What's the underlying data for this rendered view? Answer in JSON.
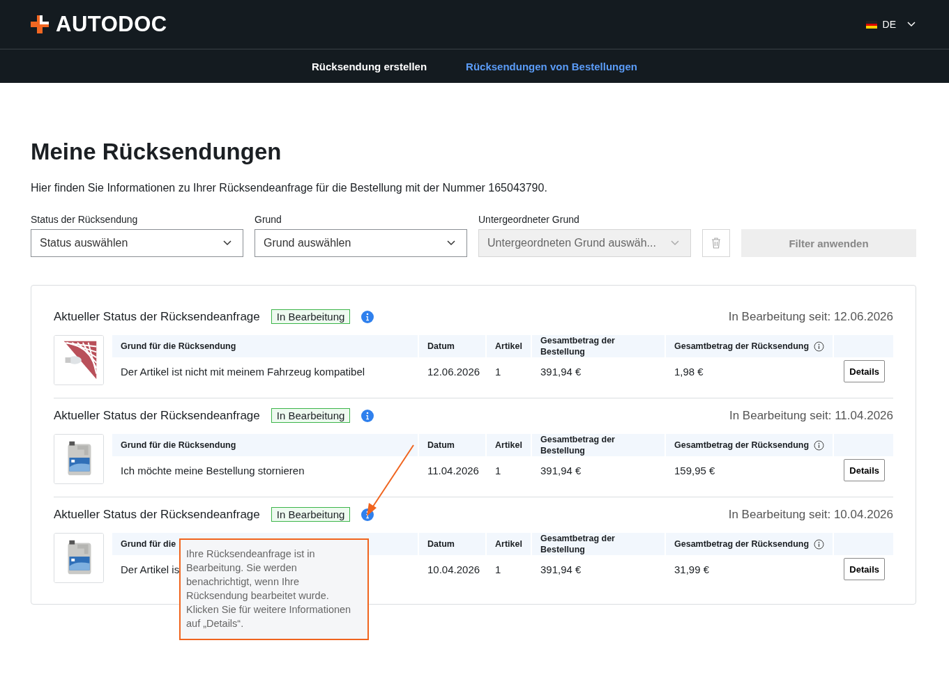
{
  "header": {
    "logo": "AUTODOC",
    "language": "DE"
  },
  "nav": [
    {
      "label": "Rücksendung erstellen",
      "selected": false
    },
    {
      "label": "Rücksendungen von Bestellungen",
      "selected": true
    }
  ],
  "page_title": "Meine Rücksendungen",
  "intro": "Hier finden Sie Informationen zu Ihrer Rücksendeanfrage für die Bestellung mit der Nummer 165043790.",
  "filters": [
    {
      "label": "Status der Rücksendung",
      "placeholder": "Status auswählen",
      "disabled": false
    },
    {
      "label": "Grund",
      "placeholder": "Grund auswählen",
      "disabled": false
    },
    {
      "label": "Untergeordneter Grund",
      "placeholder": "Untergeordneten Grund auswäh...",
      "disabled": true
    }
  ],
  "apply_button": {
    "label": "Filter anwenden",
    "disabled": true
  },
  "returns": [
    {
      "status_label": "Aktueller Status der Rücksendeanfrage",
      "badge": "In Bearbeitung",
      "since": "In Bearbeitung seit: 12.06.2026",
      "columns": [
        "Grund für die Rücksendung",
        "Datum",
        "Artikel",
        "Gesamtbetrag der Bestellung",
        "Gesamtbetrag der Rücksendung"
      ],
      "cells": [
        "Der Artikel ist nicht mit meinem Fahrzeug kompatibel",
        "12.06.2026",
        "1",
        "391,94 €",
        "1,98 €"
      ],
      "button": "Details"
    },
    {
      "status_label": "Aktueller Status der Rücksendeanfrage",
      "badge": "In Bearbeitung",
      "since": "In Bearbeitung seit: 11.04.2026",
      "columns": [
        "Grund für die Rücksendung",
        "Datum",
        "Artikel",
        "Gesamtbetrag der Bestellung",
        "Gesamtbetrag der Rücksendung"
      ],
      "cells": [
        "Ich möchte meine Bestellung stornieren",
        "11.04.2026",
        "1",
        "391,94 €",
        "159,95 €"
      ],
      "button": "Details"
    },
    {
      "status_label": "Aktueller Status der Rücksendeanfrage",
      "badge": "In Bearbeitung",
      "since": "In Bearbeitung seit: 10.04.2026",
      "columns": [
        "Grund für die",
        "Datum",
        "Artikel",
        "Gesamtbetrag der Bestellung",
        "Gesamtbetrag der Rücksendung"
      ],
      "cells": [
        "Der Artikel is",
        "10.04.2026",
        "1",
        "391,94 €",
        "31,99 €"
      ],
      "button": "Details"
    }
  ],
  "tooltip": {
    "text": "Ihre Rücksendeanfrage ist in Bearbeitung. Sie werden benachrichtigt, wenn Ihre Rücksendung bearbeitet wurde. Klicken Sie für weitere Informationen auf „Details“."
  }
}
